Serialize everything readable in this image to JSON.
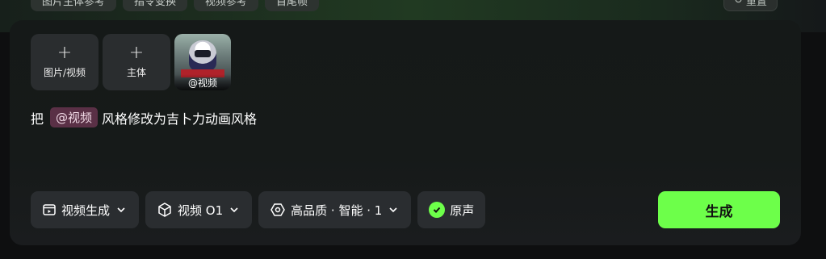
{
  "top_chips": [
    "图片主体参考",
    "指令变换",
    "视频参考",
    "首尾帧"
  ],
  "top_right_label": "重置",
  "attachments": {
    "add_media_label": "图片/视频",
    "add_subject_label": "主体",
    "video_caption": "@视频"
  },
  "prompt": {
    "prefix": "把",
    "mention": "@视频",
    "suffix": "风格修改为吉卜力动画风格"
  },
  "toolbar": {
    "mode_label": "视频生成",
    "model_label": "视频 O1",
    "quality_label": "高品质 · 智能 · 1",
    "audio_label": "原声"
  },
  "generate_label": "生成",
  "colors": {
    "accent": "#6dff4a",
    "mention_bg": "#5a3046",
    "panel_bg": "#161a19",
    "button_bg": "#2a2d30"
  },
  "icons": {
    "mode": "video-clip-icon",
    "model": "cube-icon",
    "quality": "hexagon-icon",
    "audio": "check-circle-icon",
    "dropdown": "chevron-down-icon",
    "add": "plus-icon"
  }
}
